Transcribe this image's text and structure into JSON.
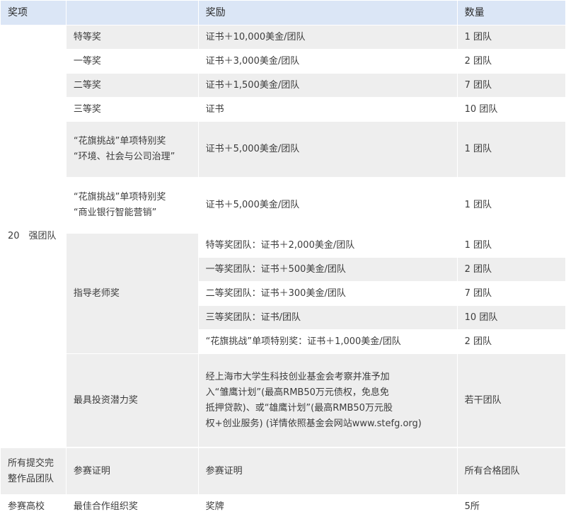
{
  "header": {
    "col_award": "奖项",
    "col_reward": "奖励",
    "col_quantity": "数量"
  },
  "group1": {
    "label": "20　强团队",
    "rows": [
      {
        "name": "特等奖",
        "reward": "证书＋10,000美金/团队",
        "qty": "1 团队"
      },
      {
        "name": "一等奖",
        "reward": "证书＋3,000美金/团队",
        "qty": "2 团队"
      },
      {
        "name": "二等奖",
        "reward": "证书＋1,500美金/团队",
        "qty": "7 团队"
      },
      {
        "name": "三等奖",
        "reward": "证书",
        "qty": "10 团队"
      },
      {
        "name_line1": "“花旗挑战”单项特别奖",
        "name_line2": "“环境、社会与公司治理”",
        "reward": "证书＋5,000美金/团队",
        "qty": "1 团队"
      },
      {
        "name_line1": "“花旗挑战”单项特别奖",
        "name_line2": "“商业银行智能营销”",
        "reward": "证书＋5,000美金/团队",
        "qty": "1 团队"
      }
    ],
    "mentor": {
      "name": "指导老师奖",
      "rows": [
        {
          "reward": "特等奖团队：证书＋2,000美金/团队",
          "qty": "1 团队"
        },
        {
          "reward": "一等奖团队：证书＋500美金/团队",
          "qty": "2 团队"
        },
        {
          "reward": "二等奖团队：证书＋300美金/团队",
          "qty": "7 团队"
        },
        {
          "reward": "三等奖团队：证书/团队",
          "qty": "10 团队"
        },
        {
          "reward": "“花旗挑战”单项特别奖：证书＋1,000美金/团队",
          "qty": "2 团队"
        }
      ]
    },
    "invest": {
      "name": "最具投资潜力奖",
      "reward_lines": [
        "经上海市大学生科技创业基金会考察并准予加",
        "入“雏鹰计划”(最高RMB50万元债权，免息免",
        "抵押贷款)、或“雄鹰计划”(最高RMB50万元股",
        "权+创业服务) (详情依照基金会网站www.stefg.org)"
      ],
      "qty": "若干团队"
    }
  },
  "group2": {
    "label_line1": "所有提交完",
    "label_line2": "整作品团队",
    "name": "参赛证明",
    "reward": "参赛证明",
    "qty": "所有合格团队"
  },
  "group3": {
    "label": "参赛高校",
    "name": "最佳合作组织奖",
    "reward": "奖牌",
    "qty": "5所"
  }
}
